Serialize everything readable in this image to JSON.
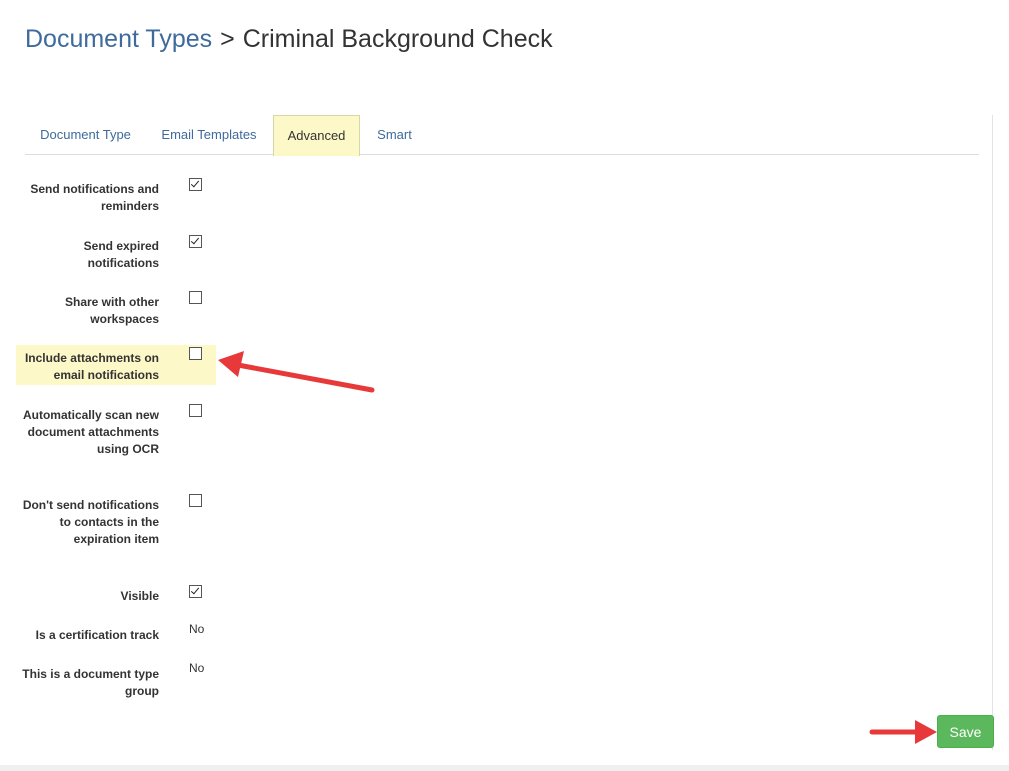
{
  "breadcrumb": {
    "parent": "Document Types",
    "separator": ">",
    "current": "Criminal Background Check"
  },
  "tabs": [
    {
      "label": "Document Type",
      "active": false
    },
    {
      "label": "Email Templates",
      "active": false
    },
    {
      "label": "Advanced",
      "active": true
    },
    {
      "label": "Smart",
      "active": false
    }
  ],
  "settings": [
    {
      "label": "Send notifications and reminders",
      "type": "checkbox",
      "checked": true
    },
    {
      "label": "Send expired notifications",
      "type": "checkbox",
      "checked": true
    },
    {
      "label": "Share with other workspaces",
      "type": "checkbox",
      "checked": false
    },
    {
      "label": "Include attachments on email notifications",
      "type": "checkbox",
      "checked": false,
      "highlighted": true
    },
    {
      "label": "Automatically scan new document attachments using OCR",
      "type": "checkbox",
      "checked": false
    },
    {
      "label": "Don't send notifications to contacts in the expiration item",
      "type": "checkbox",
      "checked": false
    },
    {
      "label": "Visible",
      "type": "checkbox",
      "checked": true
    },
    {
      "label": "Is a certification track",
      "type": "text",
      "value": "No"
    },
    {
      "label": "This is a document type group",
      "type": "text",
      "value": "No"
    }
  ],
  "save_label": "Save",
  "colors": {
    "link": "#3f6a9c",
    "highlight": "#fcf8c8",
    "save_button": "#5cb85c",
    "annotation_arrow": "#e8393a"
  }
}
